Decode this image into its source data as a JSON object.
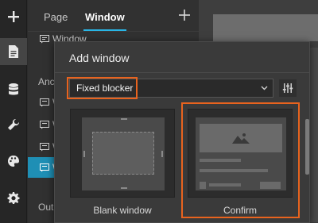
{
  "rail": {
    "items": [
      {
        "icon": "plus-icon"
      },
      {
        "icon": "page-icon",
        "active": true
      },
      {
        "icon": "database-icon"
      },
      {
        "icon": "wrench-icon"
      },
      {
        "icon": "palette-icon"
      },
      {
        "icon": "gear-icon"
      }
    ]
  },
  "panel": {
    "tabs": [
      {
        "label": "Page"
      },
      {
        "label": "Window",
        "active": true
      }
    ],
    "tree": {
      "row1": "Window",
      "section_anchor": "Anc",
      "row_w": "W",
      "section_outline": "Outl"
    }
  },
  "modal": {
    "title": "Add window",
    "select": {
      "value": "Fixed blocker"
    },
    "templates": [
      {
        "label": "Blank window"
      },
      {
        "label": "Confirm",
        "selected": true
      }
    ]
  },
  "colors": {
    "accent": "#1f8fb5",
    "highlight": "#e8631e",
    "tab_underline": "#29b6e6"
  }
}
